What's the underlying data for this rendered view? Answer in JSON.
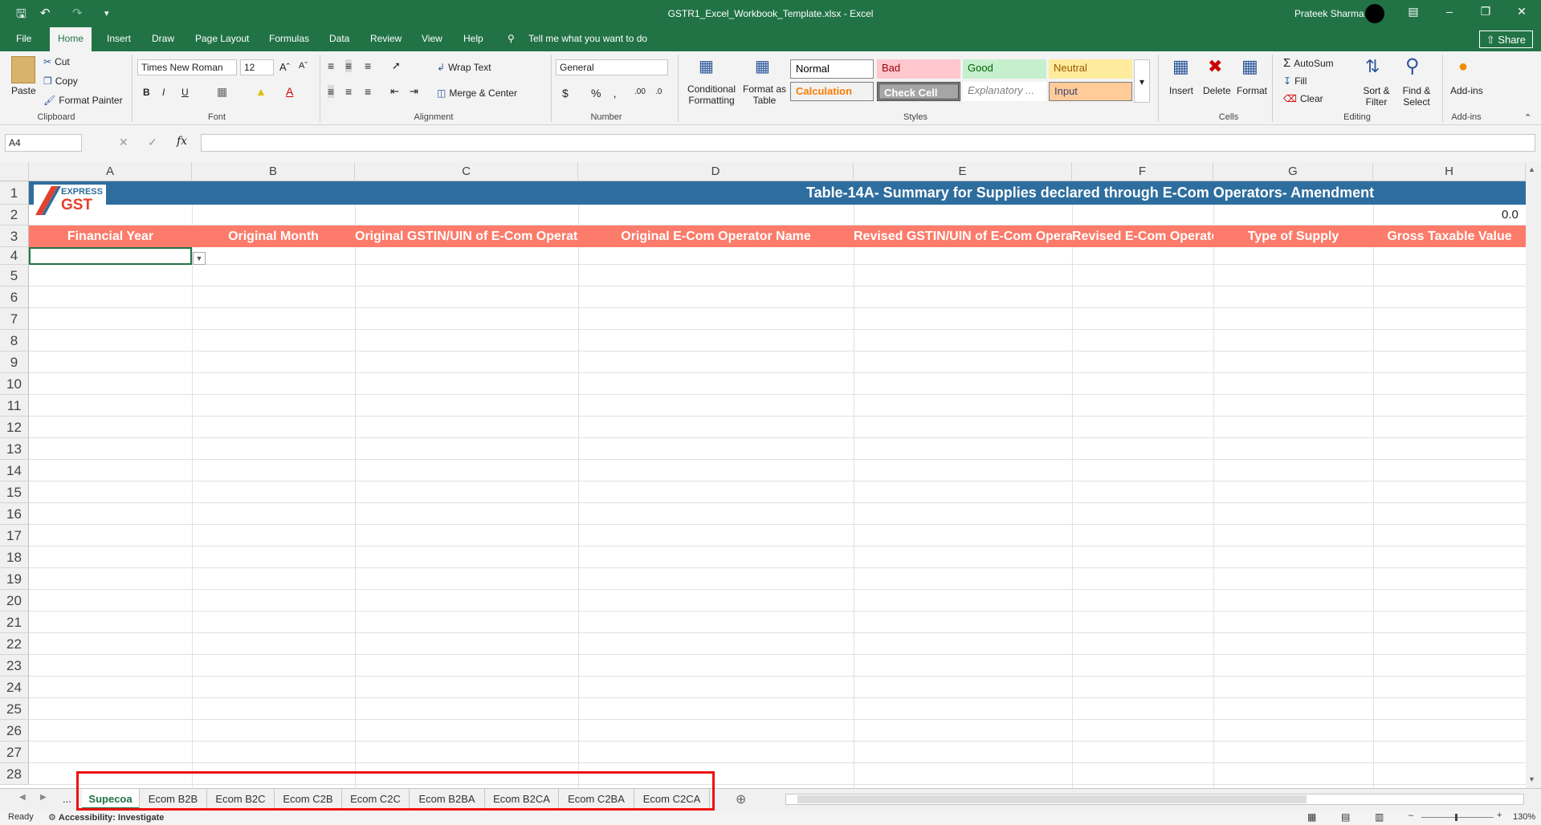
{
  "window": {
    "title": "GSTR1_Excel_Workbook_Template.xlsx  -  Excel",
    "user": "Prateek Sharma"
  },
  "ribbon_tabs": [
    "File",
    "Home",
    "Insert",
    "Draw",
    "Page Layout",
    "Formulas",
    "Data",
    "Review",
    "View",
    "Help"
  ],
  "tell_me": "Tell me what you want to do",
  "share": "Share",
  "clipboard": {
    "paste": "Paste",
    "cut": "Cut",
    "copy": "Copy",
    "format_painter": "Format Painter",
    "label": "Clipboard"
  },
  "font": {
    "name": "Times New Roman",
    "size": "12",
    "label": "Font",
    "bold": "B",
    "italic": "I",
    "underline": "U"
  },
  "alignment": {
    "wrap": "Wrap Text",
    "merge": "Merge & Center",
    "label": "Alignment"
  },
  "number": {
    "format": "General",
    "label": "Number"
  },
  "styles": {
    "conditional": "Conditional Formatting",
    "format_table": "Format as Table",
    "label": "Styles",
    "cells": [
      {
        "name": "Normal",
        "bg": "#ffffff",
        "fg": "#000000"
      },
      {
        "name": "Bad",
        "bg": "#ffc7ce",
        "fg": "#9c0006"
      },
      {
        "name": "Good",
        "bg": "#c6efce",
        "fg": "#006100"
      },
      {
        "name": "Neutral",
        "bg": "#ffeb9c",
        "fg": "#9c5700"
      },
      {
        "name": "Calculation",
        "bg": "#f2f2f2",
        "fg": "#fa7d00"
      },
      {
        "name": "Check Cell",
        "bg": "#a5a5a5",
        "fg": "#ffffff"
      },
      {
        "name": "Explanatory ...",
        "bg": "#ffffff",
        "fg": "#7f7f7f"
      },
      {
        "name": "Input",
        "bg": "#ffcc99",
        "fg": "#3f3f76"
      }
    ]
  },
  "cells_group": {
    "insert": "Insert",
    "delete": "Delete",
    "format": "Format",
    "label": "Cells"
  },
  "editing": {
    "autosum": "AutoSum",
    "fill": "Fill",
    "clear": "Clear",
    "sort": "Sort & Filter",
    "find": "Find & Select",
    "label": "Editing"
  },
  "addins": {
    "button": "Add-ins",
    "label": "Add-ins"
  },
  "namebox": "A4",
  "columns": [
    "A",
    "B",
    "C",
    "D",
    "E",
    "F",
    "G",
    "H"
  ],
  "rows": [
    "1",
    "2",
    "3",
    "4",
    "5",
    "6",
    "7",
    "8",
    "9",
    "10",
    "11",
    "12",
    "13",
    "14",
    "15",
    "16",
    "17",
    "18",
    "19",
    "20",
    "21",
    "22",
    "23",
    "24",
    "25",
    "26",
    "27",
    "28"
  ],
  "sheet": {
    "title": "Table-14A- Summary for Supplies declared through E-Com Operators- Amendment",
    "row2_value": "0.0",
    "logo_top": "EXPRESS",
    "logo_bottom": "GST",
    "headers": [
      "Financial Year",
      "Original Month",
      "Original GSTIN/UIN of E-Com Operator",
      "Original E-Com Operator Name",
      "Revised GSTIN/UIN of E-Com Operator",
      "Revised E-Com Operator Name",
      "Type of Supply",
      "Gross Taxable Value"
    ]
  },
  "sheet_tabs": [
    "Supecoa",
    "Ecom B2B",
    "Ecom B2C",
    "Ecom C2B",
    "Ecom C2C",
    "Ecom B2BA",
    "Ecom B2CA",
    "Ecom C2BA",
    "Ecom C2CA"
  ],
  "status": {
    "ready": "Ready",
    "accessibility": "Accessibility: Investigate",
    "zoom": "130%"
  }
}
